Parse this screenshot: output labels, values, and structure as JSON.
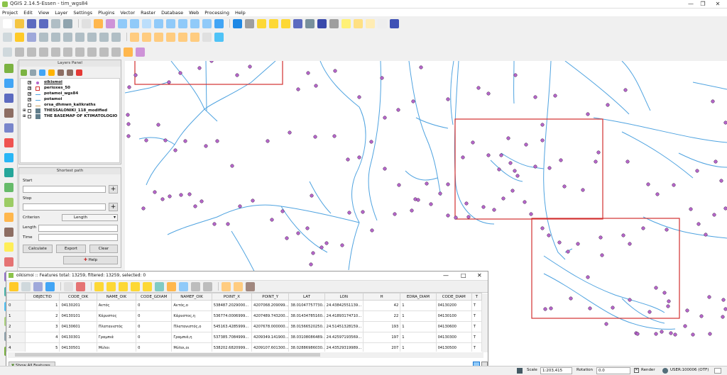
{
  "window": {
    "title": "QGIS 2.14.5-Essen - tim_wgs84"
  },
  "menu": [
    "Project",
    "Edit",
    "View",
    "Layer",
    "Settings",
    "Plugins",
    "Vector",
    "Raster",
    "Database",
    "Web",
    "Processing",
    "Help"
  ],
  "layers_panel": {
    "title": "Layers Panel",
    "layers": [
      {
        "name": "oikismoi",
        "checked": true,
        "color": "#b565c9"
      },
      {
        "name": "perioxes_50",
        "checked": true,
        "color": "#d32f2f"
      },
      {
        "name": "potamoi_wgs84",
        "checked": true,
        "color": "#4fa3e0"
      },
      {
        "name": "potamoi",
        "checked": true,
        "color": "#4fa3e0"
      },
      {
        "name": "orsa_dhmwn_kalikraths",
        "checked": false,
        "color": "#c8a060"
      },
      {
        "name": "THESSALONIKI_118_modified",
        "checked": false,
        "color": "#607d8b"
      },
      {
        "name": "THE BASEMAP OF KTIMATOLOGIO",
        "checked": false,
        "color": "#607d8b"
      }
    ]
  },
  "shortest_path": {
    "title": "Shortest path",
    "start_label": "Start",
    "stop_label": "Stop",
    "criterion_label": "Criterion",
    "criterion_value": "Length",
    "length_label": "Length",
    "time_label": "Time",
    "calculate": "Calculate",
    "export": "Export",
    "clear": "Clear",
    "help": "Help",
    "plus": "+"
  },
  "attribute_table": {
    "title": "oikismoi :: Features total: 13259, filtered: 13259, selected: 0",
    "columns": [
      "OBJECTID",
      "CODE_OIK",
      "NAME_OIK",
      "CODE_GDIAM",
      "NAMEF_OIK",
      "POINT_X",
      "POINT_Y",
      "LAT",
      "LON",
      "H",
      "EDRA_DIAM",
      "CODE_DIAM",
      "T"
    ],
    "rows": [
      {
        "idx": "0",
        "cells": [
          "1",
          "04130201",
          "Αετός",
          "0",
          "Αετός,ο",
          "538487.2029000...",
          "4207068.209099...",
          "38.01047757730...",
          "24.43842551139...",
          "42",
          "1",
          "04130200",
          "T"
        ]
      },
      {
        "idx": "1",
        "cells": [
          "2",
          "04130101",
          "Κάρυστος",
          "0",
          "Κάρυστος,η",
          "536774.0006999...",
          "4207489.743200...",
          "38.01434785160...",
          "24.41893174710...",
          "22",
          "1",
          "04130100",
          "T"
        ]
      },
      {
        "idx": "2",
        "cells": [
          "3",
          "04130601",
          "Πλατανιστός",
          "0",
          "Πλατανιστός,ο",
          "545163.4285999...",
          "4207678.000000...",
          "38.01566520250...",
          "24.51451328159...",
          "193",
          "1",
          "04130600",
          "T"
        ]
      },
      {
        "idx": "3",
        "cells": [
          "4",
          "04130301",
          "Γραμπιά",
          "0",
          "Γραμπιά,η",
          "537385.7084999...",
          "4209349.141900...",
          "38.03108086489...",
          "24.42597193569...",
          "197",
          "1",
          "04130300",
          "T"
        ]
      },
      {
        "idx": "4",
        "cells": [
          "5",
          "04130501",
          "Μύλοι",
          "0",
          "Μύλοι,οι",
          "538202.6820999...",
          "4209107.601300...",
          "38.02886986030...",
          "24.43529319989...",
          "207",
          "1",
          "04130500",
          "T"
        ]
      }
    ],
    "show_all": "Show All Features"
  },
  "statusbar": {
    "scale_label": "Scale",
    "scale_value": "1:203,415",
    "rotation_label": "Rotation",
    "rotation_value": "0.0",
    "render_label": "Render",
    "crs": "USER:100006 (OTF)"
  },
  "colors": {
    "river": "#4fa3e0",
    "settlement": "#b565c9",
    "region": "#d32f2f"
  }
}
